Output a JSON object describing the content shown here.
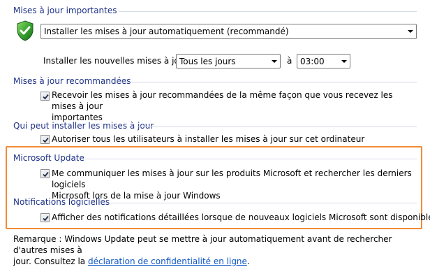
{
  "sections": {
    "important": {
      "title": "Mises à jour importantes",
      "mode_select": {
        "value": "Installer les mises à jour automatiquement (recommandé)"
      },
      "schedule": {
        "label": "Installer les nouvelles mises à jour :",
        "day_value": "Tous les jours",
        "at_label": "à",
        "time_value": "03:00"
      },
      "icon": "shield-check-icon"
    },
    "recommended": {
      "title": "Mises à jour recommandées",
      "checkbox_line1": "Recevoir les mises à jour recommandées de la même façon que vous recevez les mises à jour",
      "checkbox_line2": "importantes",
      "checked": true
    },
    "who_can_install": {
      "title": "Qui peut installer les mises à jour",
      "checkbox_label": "Autoriser tous les utilisateurs à installer les mises à jour sur cet ordinateur",
      "checked": true
    },
    "microsoft_update": {
      "title": "Microsoft Update",
      "checkbox_line1": "Me communiquer les mises à jour sur les produits Microsoft et rechercher les derniers logiciels",
      "checkbox_line2": "Microsoft lors de la mise à jour Windows",
      "checked": true
    },
    "software_notifications": {
      "title": "Notifications logicielles",
      "checkbox_label": "Afficher des notifications détaillées lorsque de nouveaux logiciels Microsoft sont disponibles",
      "checked": true
    }
  },
  "footer": {
    "line1": "Remarque : Windows Update peut se mettre à jour automatiquement avant de rechercher d'autres mises à",
    "line2_prefix": "jour. Consultez la",
    "link_text": "déclaration de confidentialité en ligne",
    "line2_suffix": "."
  },
  "colors": {
    "section_title": "#1e3287",
    "highlight_border": "#f28b36",
    "link": "#0b55c4"
  }
}
